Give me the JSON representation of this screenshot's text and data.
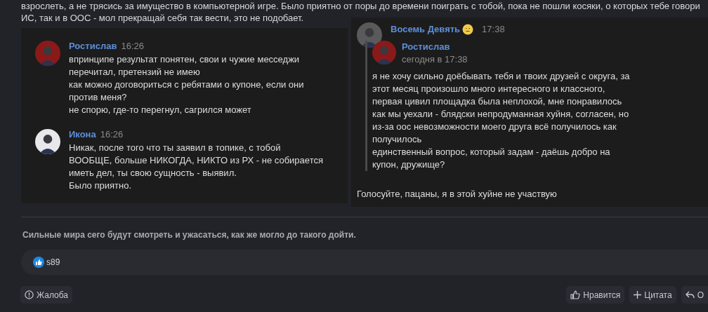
{
  "post_text": "взрослеть, а не трясись за имущество в компьютерной игре. Было приятно от поры до времени поиграть с тобой, пока не пошли косяки, о которых тебе говори\nИС, так и в ООС - мол прекращай себя так вести, это не подобает.",
  "screenshots": [
    {
      "messages": [
        {
          "author": "Ростислав",
          "time": "16:26",
          "color": "#8a1a1a",
          "text": "впринципе результат понятен, свои и чужие месседжи\nперечитал, претензий не имею\nкак можно договориться с ребятами о купоне, если они\nпротив меня?\nне спорю, где-то перегнул, сагрился может"
        },
        {
          "author": "Икона",
          "time": "16:26",
          "color": "#e8e8ec",
          "text": "Никак, после того что ты заявил в топике, с тобой\nВООБЩЕ, больше НИКОГДА, НИКТО из РХ - не собирается\nиметь дел, ты свою сущность - выявил.\nБыло приятно."
        }
      ]
    },
    {
      "messages": [
        {
          "author": "Восемь Девять",
          "time": "17:38",
          "color": "#5a5a5a",
          "emoji": true,
          "quote": {
            "author": "Ростислав",
            "time": "сегодня в 17:38",
            "color": "#8a1a1a",
            "text": "я не хочу сильно доёбывать тебя и твоих друзей с округа, за\nэтот месяц произошло много интересного и классного,\nпервая цивил площадка была неплохой, мне понравилось\nкак мы уехали - блядски непродуманная хуйня, согласен, но\nиз-за оос невозможности моего друга всё получилось как\nполучилось\nединственный вопрос, который задам - даёшь добро на\nкупон, дружище?"
          },
          "text": "Голосуйте, пацаны, я в этой хуйне не участвую"
        }
      ]
    }
  ],
  "signature": "Сильные мира сего будут смотреть и ужасаться, как же могло до такого дойти.",
  "reactions": {
    "users": "s89"
  },
  "actions": [
    {
      "kind": "report",
      "label": "Жалоба"
    },
    {
      "kind": "like",
      "label": "Нравится"
    },
    {
      "kind": "quote",
      "label": "Цитата"
    },
    {
      "kind": "reply",
      "label": "О"
    }
  ]
}
